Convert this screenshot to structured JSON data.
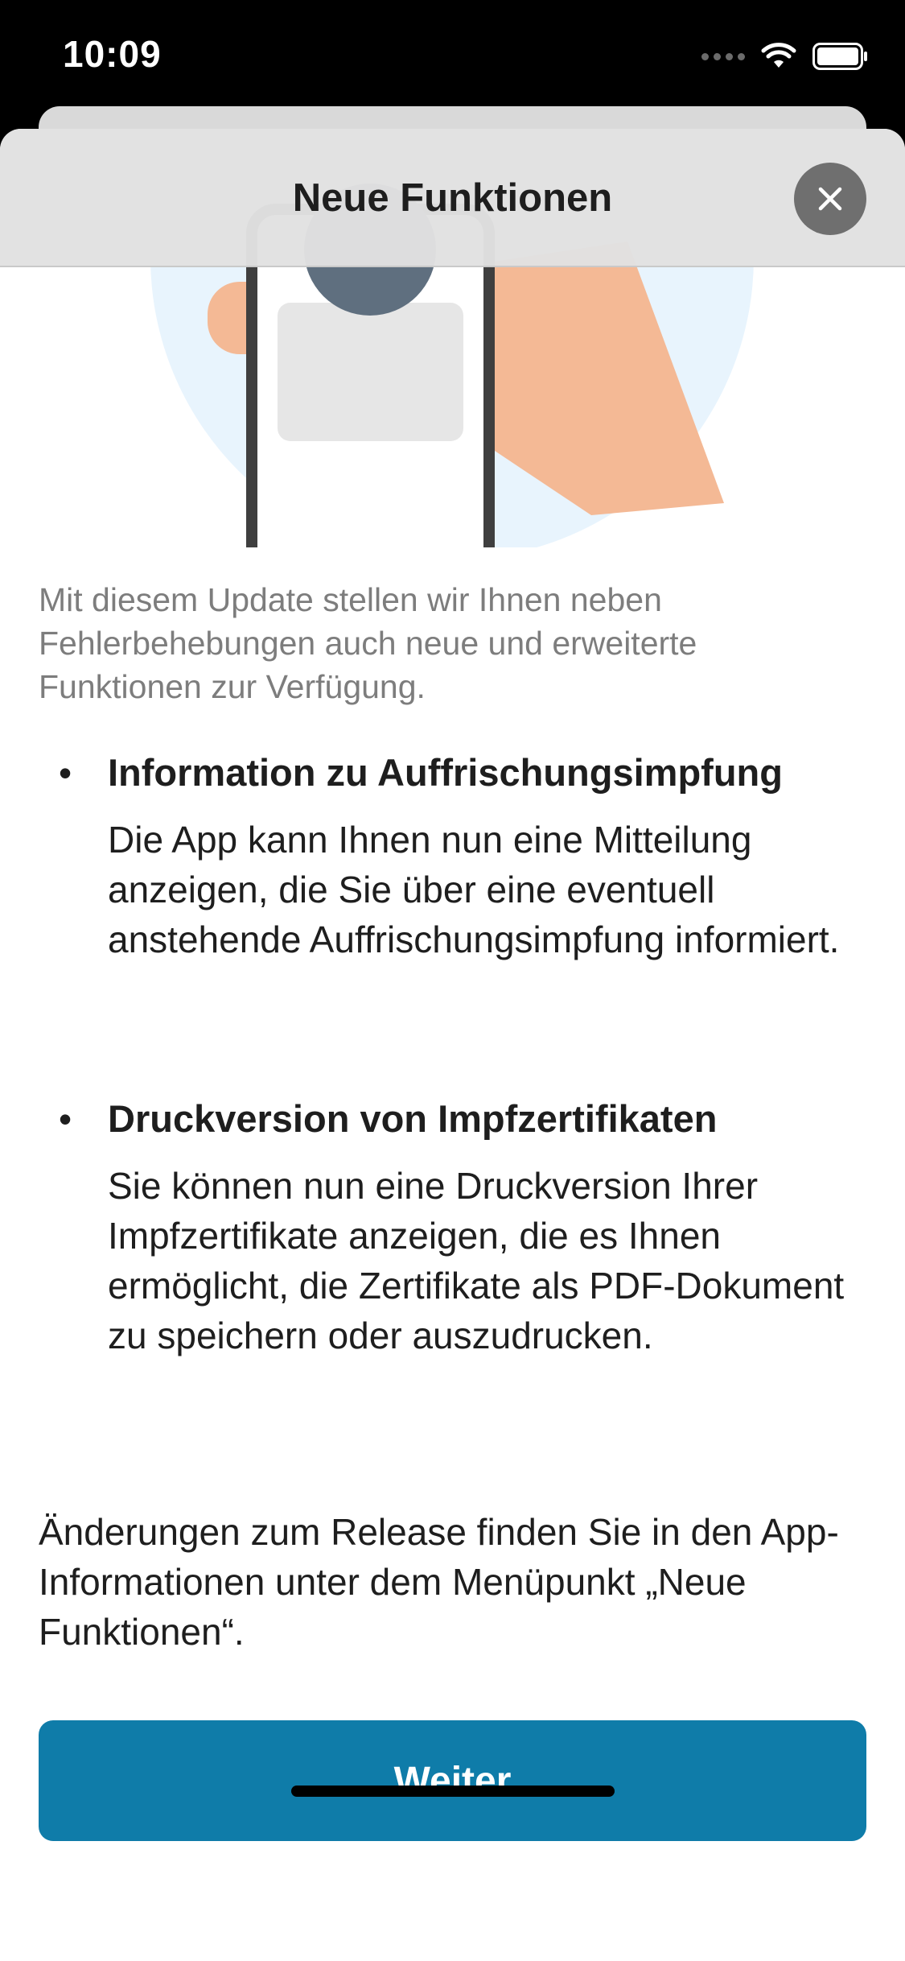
{
  "status_bar": {
    "time": "10:09",
    "icons": [
      "signal-icon",
      "wifi-icon",
      "battery-icon"
    ]
  },
  "nav": {
    "title": "Neue Funktionen",
    "close_icon": "close-icon"
  },
  "content": {
    "intro": "Mit diesem Update stellen wir Ihnen neben Fehlerbehebungen auch neue und erweiterte Funktionen zur Verfügung.",
    "features": [
      {
        "bullet": "•",
        "title": "Information zu Auffrischungsimpfung",
        "body": "Die App kann Ihnen nun eine Mitteilung anzeigen, die Sie über eine eventuell anstehende Auffrischungsimpfung informiert."
      },
      {
        "bullet": "•",
        "title": "Druckversion von Impfzertifikaten",
        "body": "Sie können nun eine Druckversion Ihrer Impfzertifikate anzeigen, die es Ihnen ermöglicht, die Zertifikate als PDF-Dokument zu speichern oder auszudrucken."
      }
    ],
    "release_note": "Änderungen zum Release finden Sie in den App-Informationen unter dem Menüpunkt „Neue Funktionen“."
  },
  "actions": {
    "continue_label": "Weiter"
  },
  "colors": {
    "accent": "#0f7ca9",
    "illustration_circle": "#e8f4fd",
    "hand": "#f4b995",
    "phone_frame": "#3f3f3f",
    "avatar": "#5f6f7f"
  }
}
